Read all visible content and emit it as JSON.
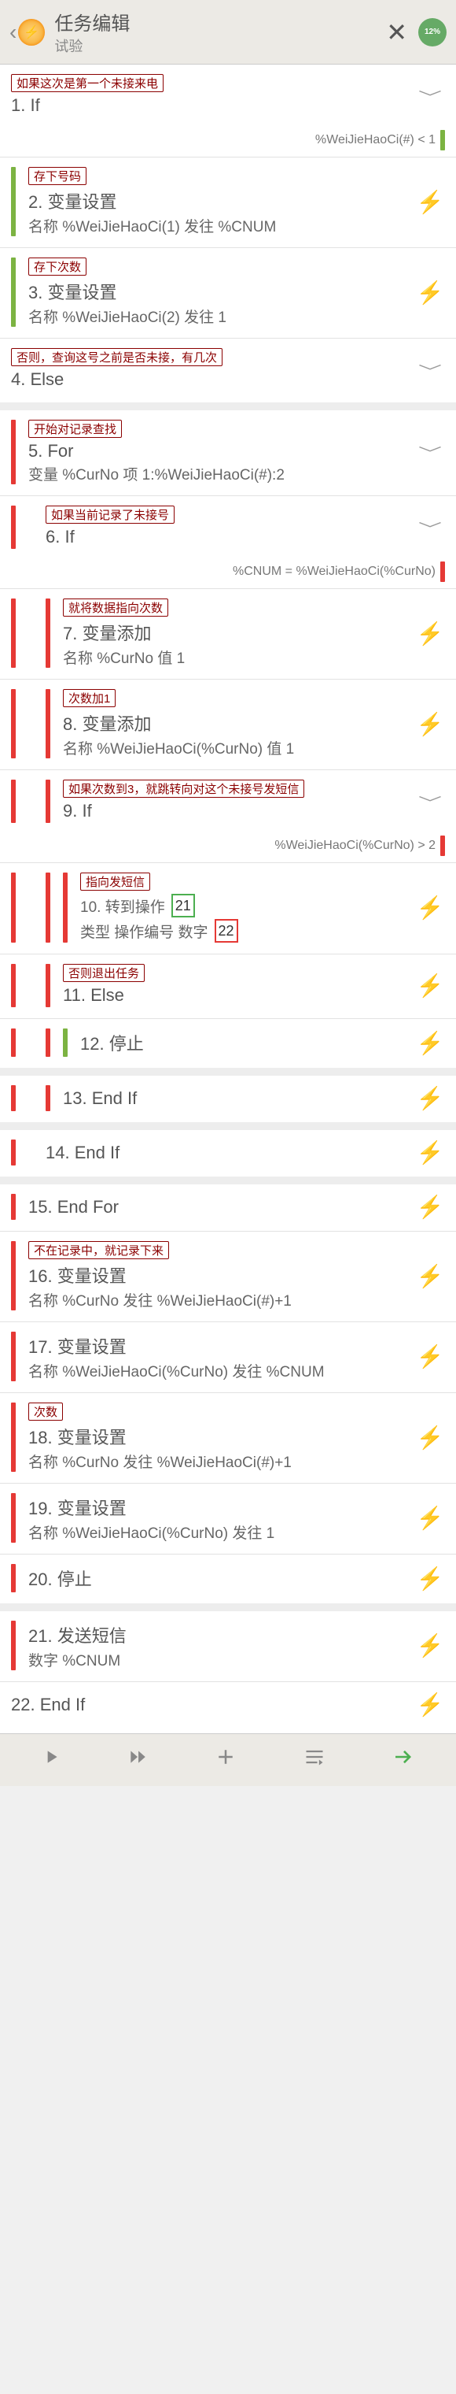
{
  "header": {
    "title": "任务编辑",
    "subtitle": "试验",
    "sync_pct": "12%"
  },
  "tags": {
    "t1": "如果这次是第一个未接来电",
    "t2": "存下号码",
    "t3": "存下次数",
    "t4": "否则，查询这号之前是否未接，有几次",
    "t5": "开始对记录查找",
    "t6": "如果当前记录了未接号",
    "t7": "就将数据指向次数",
    "t8": "次数加1",
    "t9": "如果次数到3，就跳转向对这个未接号发短信",
    "t10": "指向发短信",
    "t11": "否则退出任务",
    "t12": "不在记录中，就记录下来",
    "t13": "次数"
  },
  "actions": {
    "a1": {
      "title": "1.  If"
    },
    "c1": "%WeiJieHaoCi(#) < 1",
    "a2": {
      "title": "2.  变量设置",
      "sub": "名称 %WeiJieHaoCi(1) 发往  %CNUM"
    },
    "a3": {
      "title": "3.  变量设置",
      "sub": "名称 %WeiJieHaoCi(2) 发往  1"
    },
    "a4": {
      "title": "4.  Else"
    },
    "a5": {
      "title": "5.  For",
      "sub": "变量 %CurNo 项 1:%WeiJieHaoCi(#):2"
    },
    "a6": {
      "title": "6.  If"
    },
    "c6": "%CNUM = %WeiJieHaoCi(%CurNo)",
    "a7": {
      "title": "7.  变量添加",
      "sub": "名称 %CurNo 值  1"
    },
    "a8": {
      "title": "8.  变量添加",
      "sub": "名称 %WeiJieHaoCi(%CurNo) 值  1"
    },
    "a9": {
      "title": "9.  If"
    },
    "c9": "%WeiJieHaoCi(%CurNo) > 2",
    "a10": {
      "title": "10.  转到操作",
      "sub_pre": "类型  操作编号 数字",
      "n1": "21",
      "n2": "22"
    },
    "a11": {
      "title": "11.  Else"
    },
    "a12": {
      "title": "12.  停止"
    },
    "a13": {
      "title": "13.  End If"
    },
    "a14": {
      "title": "14.  End If"
    },
    "a15": {
      "title": "15.  End For"
    },
    "a16": {
      "title": "16.  变量设置",
      "sub": "名称 %CurNo 发往  %WeiJieHaoCi(#)+1"
    },
    "a17": {
      "title": "17.  变量设置",
      "sub": "名称 %WeiJieHaoCi(%CurNo) 发往  %CNUM"
    },
    "a18": {
      "title": "18.  变量设置",
      "sub": "名称 %CurNo 发往  %WeiJieHaoCi(#)+1"
    },
    "a19": {
      "title": "19.  变量设置",
      "sub": "名称 %WeiJieHaoCi(%CurNo) 发往  1"
    },
    "a20": {
      "title": "20.  停止"
    },
    "a21": {
      "title": "21.  发送短信",
      "sub": "数字  %CNUM"
    },
    "a22": {
      "title": "22.  End If"
    }
  }
}
